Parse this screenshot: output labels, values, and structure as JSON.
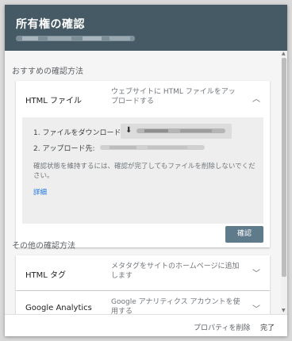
{
  "dialog": {
    "title": "所有権の確認",
    "recommended_label": "おすすめの確認方法",
    "other_label": "その他の確認方法"
  },
  "html_file": {
    "name": "HTML ファイル",
    "desc": "ウェブサイトに HTML ファイルをアップロードする",
    "step1": "1. ファイルをダウンロード:",
    "step2": "2. アップロード先:",
    "note": "確認状態を維持するには、確認が完了してもファイルを削除しないでください。",
    "link": "詳細",
    "confirm_button": "確認"
  },
  "html_tag": {
    "name": "HTML タグ",
    "desc": "メタタグをサイトのホームページに追加します"
  },
  "google_analytics": {
    "name": "Google Analytics",
    "desc": "Google アナリティクス アカウントを使用する"
  },
  "footer": {
    "delete_property": "プロパティを削除",
    "done": "完了"
  },
  "icons": {
    "chevron_up": "chevron-up-icon",
    "chevron_down": "chevron-down-icon",
    "download": "download-icon"
  }
}
